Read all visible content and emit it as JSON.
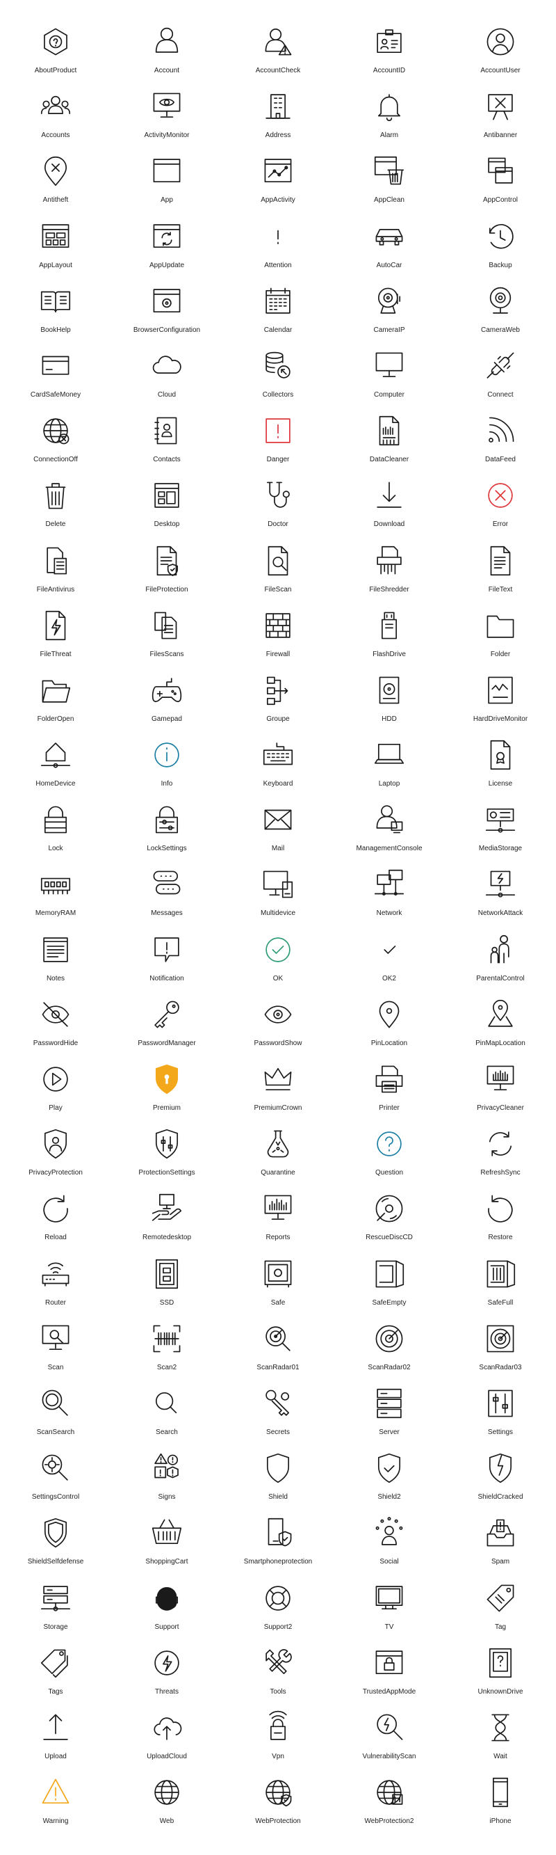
{
  "icons": [
    {
      "label": "AboutProduct",
      "icon": "about-product-icon"
    },
    {
      "label": "Account",
      "icon": "account-icon"
    },
    {
      "label": "AccountCheck",
      "icon": "account-check-icon"
    },
    {
      "label": "AccountID",
      "icon": "account-id-icon"
    },
    {
      "label": "AccountUser",
      "icon": "account-user-icon"
    },
    {
      "label": "Accounts",
      "icon": "accounts-icon"
    },
    {
      "label": "ActivityMonitor",
      "icon": "activity-monitor-icon"
    },
    {
      "label": "Address",
      "icon": "address-icon"
    },
    {
      "label": "Alarm",
      "icon": "alarm-icon"
    },
    {
      "label": "Antibanner",
      "icon": "antibanner-icon"
    },
    {
      "label": "Antitheft",
      "icon": "antitheft-icon"
    },
    {
      "label": "App",
      "icon": "app-icon"
    },
    {
      "label": "AppActivity",
      "icon": "app-activity-icon"
    },
    {
      "label": "AppClean",
      "icon": "app-clean-icon"
    },
    {
      "label": "AppControl",
      "icon": "app-control-icon"
    },
    {
      "label": "AppLayout",
      "icon": "app-layout-icon"
    },
    {
      "label": "AppUpdate",
      "icon": "app-update-icon"
    },
    {
      "label": "Attention",
      "icon": "attention-icon"
    },
    {
      "label": "AutoCar",
      "icon": "auto-car-icon"
    },
    {
      "label": "Backup",
      "icon": "backup-icon"
    },
    {
      "label": "BookHelp",
      "icon": "book-help-icon"
    },
    {
      "label": "BrowserConfiguration",
      "icon": "browser-configuration-icon"
    },
    {
      "label": "Calendar",
      "icon": "calendar-icon"
    },
    {
      "label": "CameraIP",
      "icon": "camera-ip-icon"
    },
    {
      "label": "CameraWeb",
      "icon": "camera-web-icon"
    },
    {
      "label": "CardSafeMoney",
      "icon": "card-safe-money-icon"
    },
    {
      "label": "Cloud",
      "icon": "cloud-icon"
    },
    {
      "label": "Collectors",
      "icon": "collectors-icon"
    },
    {
      "label": "Computer",
      "icon": "computer-icon"
    },
    {
      "label": "Connect",
      "icon": "connect-icon"
    },
    {
      "label": "ConnectionOff",
      "icon": "connection-off-icon"
    },
    {
      "label": "Contacts",
      "icon": "contacts-icon"
    },
    {
      "label": "Danger",
      "icon": "danger-icon"
    },
    {
      "label": "DataCleaner",
      "icon": "data-cleaner-icon"
    },
    {
      "label": "DataFeed",
      "icon": "data-feed-icon"
    },
    {
      "label": "Delete",
      "icon": "delete-icon"
    },
    {
      "label": "Desktop",
      "icon": "desktop-icon"
    },
    {
      "label": "Doctor",
      "icon": "doctor-icon"
    },
    {
      "label": "Download",
      "icon": "download-icon"
    },
    {
      "label": "Error",
      "icon": "error-icon"
    },
    {
      "label": "FileAntivirus",
      "icon": "file-antivirus-icon"
    },
    {
      "label": "FileProtection",
      "icon": "file-protection-icon"
    },
    {
      "label": "FileScan",
      "icon": "file-scan-icon"
    },
    {
      "label": "FileShredder",
      "icon": "file-shredder-icon"
    },
    {
      "label": "FileText",
      "icon": "file-text-icon"
    },
    {
      "label": "FileThreat",
      "icon": "file-threat-icon"
    },
    {
      "label": "FilesScans",
      "icon": "files-scans-icon"
    },
    {
      "label": "Firewall",
      "icon": "firewall-icon"
    },
    {
      "label": "FlashDrive",
      "icon": "flash-drive-icon"
    },
    {
      "label": "Folder",
      "icon": "folder-icon"
    },
    {
      "label": "FolderOpen",
      "icon": "folder-open-icon"
    },
    {
      "label": "Gamepad",
      "icon": "gamepad-icon"
    },
    {
      "label": "Groupe",
      "icon": "groupe-icon"
    },
    {
      "label": "HDD",
      "icon": "hdd-icon"
    },
    {
      "label": "HardDriveMonitor",
      "icon": "hard-drive-monitor-icon"
    },
    {
      "label": "HomeDevice",
      "icon": "home-device-icon"
    },
    {
      "label": "Info",
      "icon": "info-icon"
    },
    {
      "label": "Keyboard",
      "icon": "keyboard-icon"
    },
    {
      "label": "Laptop",
      "icon": "laptop-icon"
    },
    {
      "label": "License",
      "icon": "license-icon"
    },
    {
      "label": "Lock",
      "icon": "lock-icon"
    },
    {
      "label": "LockSettings",
      "icon": "lock-settings-icon"
    },
    {
      "label": "Mail",
      "icon": "mail-icon"
    },
    {
      "label": "ManagementConsole",
      "icon": "management-console-icon"
    },
    {
      "label": "MediaStorage",
      "icon": "media-storage-icon"
    },
    {
      "label": "MemoryRAM",
      "icon": "memory-ram-icon"
    },
    {
      "label": "Messages",
      "icon": "messages-icon"
    },
    {
      "label": "Multidevice",
      "icon": "multidevice-icon"
    },
    {
      "label": "Network",
      "icon": "network-icon"
    },
    {
      "label": "NetworkAttack",
      "icon": "network-attack-icon"
    },
    {
      "label": "Notes",
      "icon": "notes-icon"
    },
    {
      "label": "Notification",
      "icon": "notification-icon"
    },
    {
      "label": "OK",
      "icon": "ok-icon"
    },
    {
      "label": "OK2",
      "icon": "ok2-icon"
    },
    {
      "label": "ParentalControl",
      "icon": "parental-control-icon"
    },
    {
      "label": "PasswordHide",
      "icon": "password-hide-icon"
    },
    {
      "label": "PasswordManager",
      "icon": "password-manager-icon"
    },
    {
      "label": "PasswordShow",
      "icon": "password-show-icon"
    },
    {
      "label": "PinLocation",
      "icon": "pin-location-icon"
    },
    {
      "label": "PinMapLocation",
      "icon": "pin-map-location-icon"
    },
    {
      "label": "Play",
      "icon": "play-icon"
    },
    {
      "label": "Premium",
      "icon": "premium-icon"
    },
    {
      "label": "PremiumCrown",
      "icon": "premium-crown-icon"
    },
    {
      "label": "Printer",
      "icon": "printer-icon"
    },
    {
      "label": "PrivacyCleaner",
      "icon": "privacy-cleaner-icon"
    },
    {
      "label": "PrivacyProtection",
      "icon": "privacy-protection-icon"
    },
    {
      "label": "ProtectionSettings",
      "icon": "protection-settings-icon"
    },
    {
      "label": "Quarantine",
      "icon": "quarantine-icon"
    },
    {
      "label": "Question",
      "icon": "question-icon"
    },
    {
      "label": "RefreshSync",
      "icon": "refresh-sync-icon"
    },
    {
      "label": "Reload",
      "icon": "reload-icon"
    },
    {
      "label": "Remotedesktop",
      "icon": "remote-desktop-icon"
    },
    {
      "label": "Reports",
      "icon": "reports-icon"
    },
    {
      "label": "RescueDiscCD",
      "icon": "rescue-disc-cd-icon"
    },
    {
      "label": "Restore",
      "icon": "restore-icon"
    },
    {
      "label": "Router",
      "icon": "router-icon"
    },
    {
      "label": "SSD",
      "icon": "ssd-icon"
    },
    {
      "label": "Safe",
      "icon": "safe-icon"
    },
    {
      "label": "SafeEmpty",
      "icon": "safe-empty-icon"
    },
    {
      "label": "SafeFull",
      "icon": "safe-full-icon"
    },
    {
      "label": "Scan",
      "icon": "scan-icon"
    },
    {
      "label": "Scan2",
      "icon": "scan2-icon"
    },
    {
      "label": "ScanRadar01",
      "icon": "scan-radar01-icon"
    },
    {
      "label": "ScanRadar02",
      "icon": "scan-radar02-icon"
    },
    {
      "label": "ScanRadar03",
      "icon": "scan-radar03-icon"
    },
    {
      "label": "ScanSearch",
      "icon": "scan-search-icon"
    },
    {
      "label": "Search",
      "icon": "search-icon"
    },
    {
      "label": "Secrets",
      "icon": "secrets-icon"
    },
    {
      "label": "Server",
      "icon": "server-icon"
    },
    {
      "label": "Settings",
      "icon": "settings-icon"
    },
    {
      "label": "SettingsControl",
      "icon": "settings-control-icon"
    },
    {
      "label": "Signs",
      "icon": "signs-icon"
    },
    {
      "label": "Shield",
      "icon": "shield-icon"
    },
    {
      "label": "Shield2",
      "icon": "shield2-icon"
    },
    {
      "label": "ShieldCracked",
      "icon": "shield-cracked-icon"
    },
    {
      "label": "ShieldSelfdefense",
      "icon": "shield-selfdefense-icon"
    },
    {
      "label": "ShoppingCart",
      "icon": "shopping-cart-icon"
    },
    {
      "label": "Smartphoneprotection",
      "icon": "smartphone-protection-icon"
    },
    {
      "label": "Social",
      "icon": "social-icon"
    },
    {
      "label": "Spam",
      "icon": "spam-icon"
    },
    {
      "label": "Storage",
      "icon": "storage-icon"
    },
    {
      "label": "Support",
      "icon": "support-icon"
    },
    {
      "label": "Support2",
      "icon": "support2-icon"
    },
    {
      "label": "TV",
      "icon": "tv-icon"
    },
    {
      "label": "Tag",
      "icon": "tag-icon"
    },
    {
      "label": "Tags",
      "icon": "tags-icon"
    },
    {
      "label": "Threats",
      "icon": "threats-icon"
    },
    {
      "label": "Tools",
      "icon": "tools-icon"
    },
    {
      "label": "TrustedAppMode",
      "icon": "trusted-app-mode-icon"
    },
    {
      "label": "UnknownDrive",
      "icon": "unknown-drive-icon"
    },
    {
      "label": "Upload",
      "icon": "upload-icon"
    },
    {
      "label": "UploadCloud",
      "icon": "upload-cloud-icon"
    },
    {
      "label": "Vpn",
      "icon": "vpn-icon"
    },
    {
      "label": "VulnerabilityScan",
      "icon": "vulnerability-scan-icon"
    },
    {
      "label": "Wait",
      "icon": "wait-icon"
    },
    {
      "label": "Warning",
      "icon": "warning-icon"
    },
    {
      "label": "Web",
      "icon": "web-icon"
    },
    {
      "label": "WebProtection",
      "icon": "web-protection-icon"
    },
    {
      "label": "WebProtection2",
      "icon": "web-protection2-icon"
    },
    {
      "label": "iPhone",
      "icon": "iphone-icon"
    }
  ],
  "colors": {
    "stroke": "#1a1a1a",
    "danger": "#e0353a",
    "info": "#1a7fa3",
    "ok": "#2e9b78",
    "premium": "#f3a81b",
    "warning": "#f3a81b"
  }
}
